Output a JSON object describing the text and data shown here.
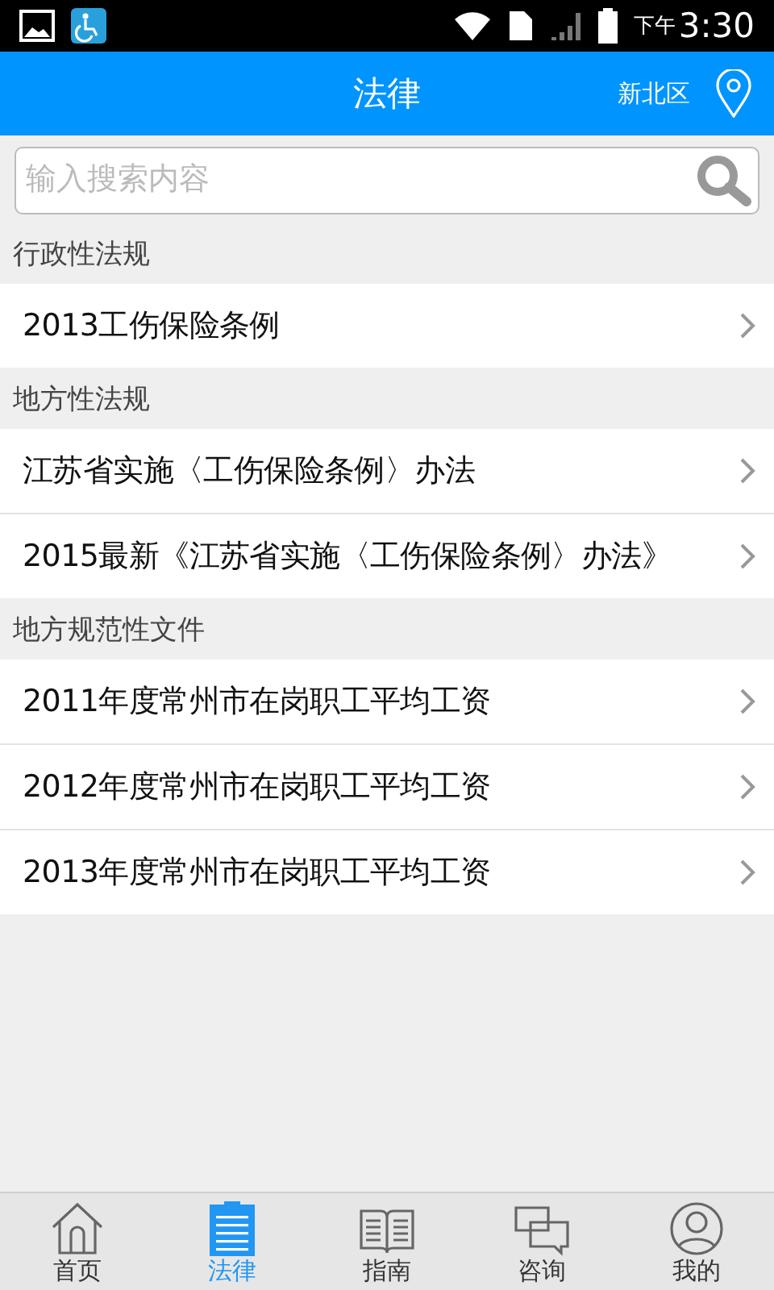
{
  "status_bar": {
    "ampm": "下午",
    "time": "3:30"
  },
  "header": {
    "title": "法律",
    "location": "新北区"
  },
  "search": {
    "placeholder": "输入搜索内容"
  },
  "sections": [
    {
      "title": "行政性法规",
      "items": [
        "2013工伤保险条例"
      ]
    },
    {
      "title": "地方性法规",
      "items": [
        "江苏省实施〈工伤保险条例〉办法",
        "2015最新《江苏省实施〈工伤保险条例〉办法》"
      ]
    },
    {
      "title": "地方规范性文件",
      "items": [
        "2011年度常州市在岗职工平均工资",
        "2012年度常州市在岗职工平均工资",
        "2013年度常州市在岗职工平均工资"
      ]
    }
  ],
  "tabs": [
    {
      "kind": "home",
      "label": "首页",
      "selected": false
    },
    {
      "kind": "law",
      "label": "法律",
      "selected": true
    },
    {
      "kind": "guide",
      "label": "指南",
      "selected": false
    },
    {
      "kind": "chat",
      "label": "咨询",
      "selected": false
    },
    {
      "kind": "me",
      "label": "我的",
      "selected": false
    }
  ]
}
